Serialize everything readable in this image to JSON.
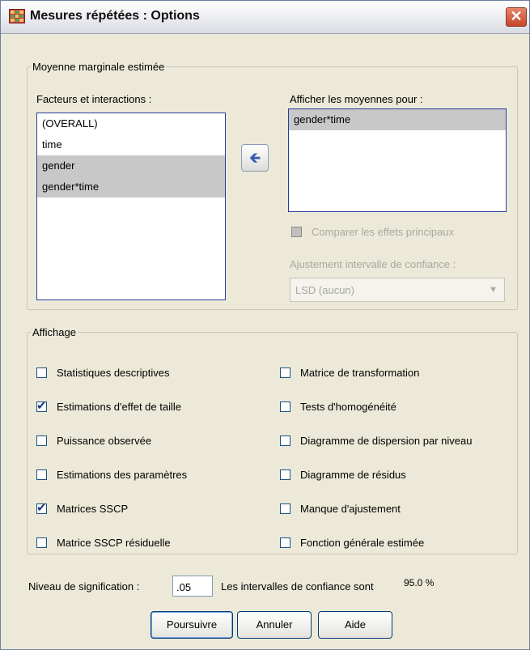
{
  "window": {
    "title": "Mesures répétées : Options"
  },
  "estimated_means": {
    "group_label": "Moyenne marginale estimée",
    "factors_label": "Facteurs et interactions :",
    "factors": [
      {
        "label": "(OVERALL)",
        "selected": false
      },
      {
        "label": "time",
        "selected": false
      },
      {
        "label": "gender",
        "selected": true
      },
      {
        "label": "gender*time",
        "selected": true
      }
    ],
    "display_means_label": "Afficher les moyennes pour :",
    "display_means": [
      {
        "label": "gender*time",
        "selected": true
      }
    ],
    "compare_main_effects_label": "Comparer les effets principaux",
    "ci_adjustment_label": "Ajustement intervalle de confiance :",
    "ci_adjustment_value": "LSD (aucun)"
  },
  "display": {
    "group_label": "Affichage",
    "left": [
      {
        "label": "Statistiques descriptives",
        "checked": false
      },
      {
        "label": "Estimations d'effet de taille",
        "checked": true
      },
      {
        "label": "Puissance observée",
        "checked": false
      },
      {
        "label": "Estimations des paramètres",
        "checked": false
      },
      {
        "label": "Matrices SSCP",
        "checked": true
      },
      {
        "label": "Matrice SSCP résiduelle",
        "checked": false
      }
    ],
    "right": [
      {
        "label": "Matrice de transformation",
        "checked": false
      },
      {
        "label": "Tests d'homogénéité",
        "checked": false
      },
      {
        "label": "Diagramme de dispersion par niveau",
        "checked": false
      },
      {
        "label": "Diagramme de résidus",
        "checked": false
      },
      {
        "label": "Manque d'ajustement",
        "checked": false
      },
      {
        "label": "Fonction générale estimée",
        "checked": false
      }
    ]
  },
  "significance": {
    "label": "Niveau de signification :",
    "value": ".05",
    "ci_text": "Les intervalles de confiance sont",
    "ci_value": "95.0 %"
  },
  "buttons": {
    "continue": "Poursuivre",
    "cancel": "Annuler",
    "help": "Aide"
  }
}
